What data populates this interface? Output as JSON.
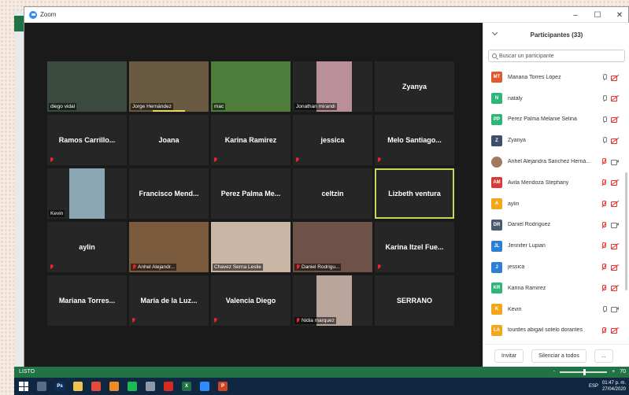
{
  "window": {
    "title": "Zoom",
    "minimize": "–",
    "maximize": "☐",
    "close": "✕"
  },
  "excel": {
    "status": "LISTO",
    "zoom_minus": "-",
    "zoom_plus": "+",
    "zoom": "70"
  },
  "tiles": [
    {
      "label": "diego vidal",
      "type": "video",
      "bg": "#3a4a3e"
    },
    {
      "label": "Jorge Hernández",
      "type": "video",
      "bg": "#6b5a42",
      "speaking": true
    },
    {
      "label": "mac",
      "type": "video",
      "bg": "#4e7d3b"
    },
    {
      "label": "Jonathan mirandi",
      "type": "video",
      "bg": "#b98f9a"
    },
    {
      "name": "Zyanya",
      "type": "name"
    },
    {
      "name": "Ramos  Carrillo...",
      "type": "name",
      "muted": true
    },
    {
      "name": "Joana",
      "type": "name"
    },
    {
      "name": "Karina Ramirez",
      "type": "name",
      "muted": true
    },
    {
      "name": "jessica",
      "type": "name",
      "muted": true
    },
    {
      "name": "Melo  Santiago...",
      "type": "name",
      "muted": true
    },
    {
      "label": "Kevin",
      "type": "video",
      "bg": "#8aa7b3"
    },
    {
      "name": "Francisco  Mend...",
      "type": "name"
    },
    {
      "name": "Perez Palma Me...",
      "type": "name"
    },
    {
      "name": "celtzin",
      "type": "name"
    },
    {
      "name": "Lizbeth ventura",
      "type": "name",
      "active": true
    },
    {
      "name": "aylin",
      "type": "name",
      "muted": true
    },
    {
      "label": "Anhel Alejandr...",
      "type": "video",
      "bg": "#7a5a3c",
      "muted": true
    },
    {
      "label": "Chavez Serna Leslie",
      "type": "video",
      "bg": "#c9b6a4"
    },
    {
      "label": "Daniel Rodrigu...",
      "type": "video",
      "bg": "#6e5248",
      "muted": true
    },
    {
      "name": "Karina Itzel Fue...",
      "type": "name",
      "muted": true
    },
    {
      "name": "Mariana  Torres...",
      "type": "name"
    },
    {
      "name": "María de la Luz...",
      "type": "name",
      "muted": true
    },
    {
      "name": "Valencia Diego",
      "type": "name",
      "muted": true
    },
    {
      "label": "Nidia marquez",
      "type": "video",
      "bg": "#b9a59a",
      "muted": true
    },
    {
      "name": "SERRANO",
      "type": "name"
    }
  ],
  "panel": {
    "title": "Participantes (33)",
    "search_placeholder": "Buscar un participante",
    "participants": [
      {
        "initials": "MT",
        "color": "#e0582b",
        "name": "Mariana Torres López",
        "mic": "on",
        "cam": "off"
      },
      {
        "initials": "N",
        "color": "#2fb575",
        "name": "nataly",
        "mic": "on",
        "cam": "off"
      },
      {
        "initials": "PP",
        "color": "#2fb575",
        "name": "Perez Palma Melanie Selina",
        "mic": "on",
        "cam": "off"
      },
      {
        "initials": "Z",
        "color": "#3d4f6b",
        "name": "Zyanya",
        "mic": "on",
        "cam": "off"
      },
      {
        "initials": "",
        "color": "#a07a5e",
        "name": "Anhel Alejandra Sanchez Herná...",
        "mic": "off",
        "cam": "on",
        "photo": true
      },
      {
        "initials": "AM",
        "color": "#d93a3a",
        "name": "Avila Mendoza Stephany",
        "mic": "off",
        "cam": "off"
      },
      {
        "initials": "A",
        "color": "#f2a71b",
        "name": "aylin",
        "mic": "off",
        "cam": "off"
      },
      {
        "initials": "DR",
        "color": "#4a5a72",
        "name": "Daniel Rodríguez",
        "mic": "off",
        "cam": "on"
      },
      {
        "initials": "JL",
        "color": "#2d7fd6",
        "name": "Jennifer Lupian",
        "mic": "off",
        "cam": "off"
      },
      {
        "initials": "J",
        "color": "#2d7fd6",
        "name": "jessica",
        "mic": "off",
        "cam": "off"
      },
      {
        "initials": "KR",
        "color": "#2fb575",
        "name": "Karina Ramirez",
        "mic": "off",
        "cam": "off"
      },
      {
        "initials": "K",
        "color": "#f2a71b",
        "name": "Kevin",
        "mic": "on",
        "cam": "on"
      },
      {
        "initials": "LA",
        "color": "#f2a71b",
        "name": "lourdes abigail sotelo dorantes",
        "mic": "off",
        "cam": "off"
      }
    ],
    "invite": "Invitar",
    "mute_all": "Silenciar a todos",
    "more": "..."
  },
  "taskbar": {
    "icons": [
      {
        "name": "task-view-icon",
        "color": "#5b6d84",
        "label": ""
      },
      {
        "name": "photoshop-icon",
        "color": "#0b2f5a",
        "label": "Ps"
      },
      {
        "name": "file-explorer-icon",
        "color": "#f2c14e",
        "label": ""
      },
      {
        "name": "chrome-icon",
        "color": "#e34b3b",
        "label": ""
      },
      {
        "name": "firefox-icon",
        "color": "#f08a24",
        "label": ""
      },
      {
        "name": "spotify-icon",
        "color": "#1db954",
        "label": ""
      },
      {
        "name": "camera-icon",
        "color": "#8e9aa8",
        "label": ""
      },
      {
        "name": "acrobat-icon",
        "color": "#d82a20",
        "label": ""
      },
      {
        "name": "excel-icon",
        "color": "#217346",
        "label": "X"
      },
      {
        "name": "zoom-icon",
        "color": "#2d8cff",
        "label": ""
      },
      {
        "name": "powerpoint-icon",
        "color": "#d04423",
        "label": "P"
      }
    ],
    "lang": "ESP",
    "time": "01:47 p. m.",
    "date": "27/04/2020"
  }
}
